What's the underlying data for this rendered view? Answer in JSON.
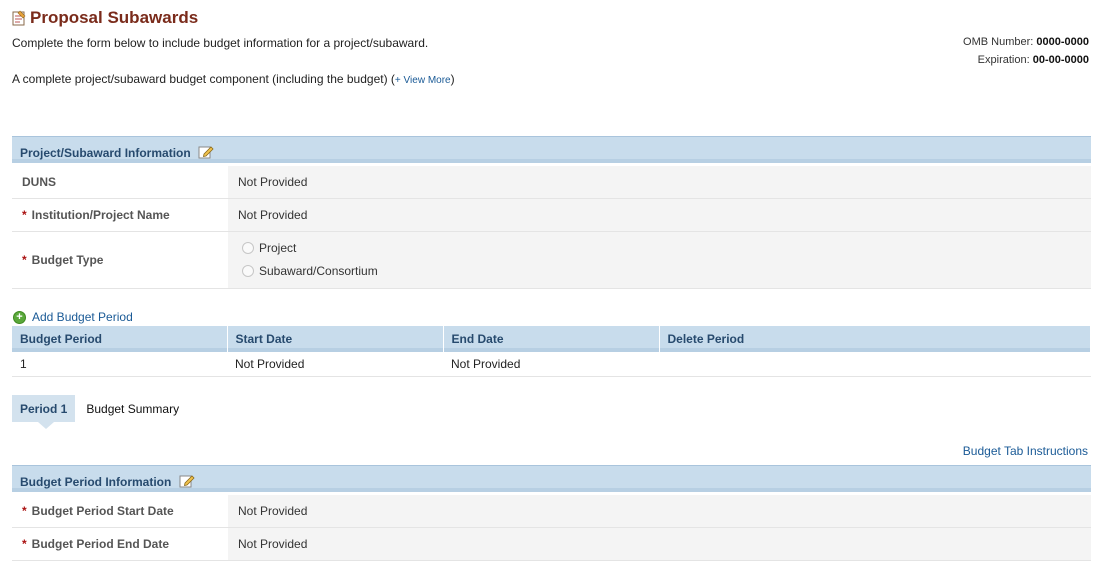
{
  "header": {
    "title": "Proposal Subawards",
    "intro": "Complete the form below to include budget information for a project/subaward.",
    "intro2": "A complete project/subaward budget component (including the budget)",
    "view_more_prefix": "(",
    "view_more": "+ View More",
    "view_more_suffix": ")",
    "omb_label": "OMB Number:",
    "omb_value": "0000-0000",
    "expiration_label": "Expiration:",
    "expiration_value": "00-00-0000"
  },
  "project_section": {
    "title": "Project/Subaward Information",
    "duns_label": "DUNS",
    "duns_value": "Not Provided",
    "institution_label": "Institution/Project Name",
    "institution_value": "Not Provided",
    "budget_type_label": "Budget Type",
    "budget_type_options": [
      "Project",
      "Subaward/Consortium"
    ]
  },
  "periods": {
    "add_label": "Add Budget Period",
    "columns": [
      "Budget Period",
      "Start Date",
      "End Date",
      "Delete Period"
    ],
    "rows": [
      [
        "1",
        "Not Provided",
        "Not Provided",
        ""
      ]
    ]
  },
  "tabs": {
    "items": [
      "Period 1",
      "Budget Summary"
    ],
    "active": "Period 1"
  },
  "instructions_link": "Budget Tab Instructions",
  "period_section": {
    "title": "Budget Period Information",
    "start_label": "Budget Period Start Date",
    "start_value": "Not Provided",
    "end_label": "Budget Period End Date",
    "end_value": "Not Provided"
  },
  "required_marker": "*",
  "colors": {
    "title": "#7a2b1b",
    "section_header_bg": "#c8dcec",
    "link": "#1a5a96",
    "required": "#aa1111"
  }
}
